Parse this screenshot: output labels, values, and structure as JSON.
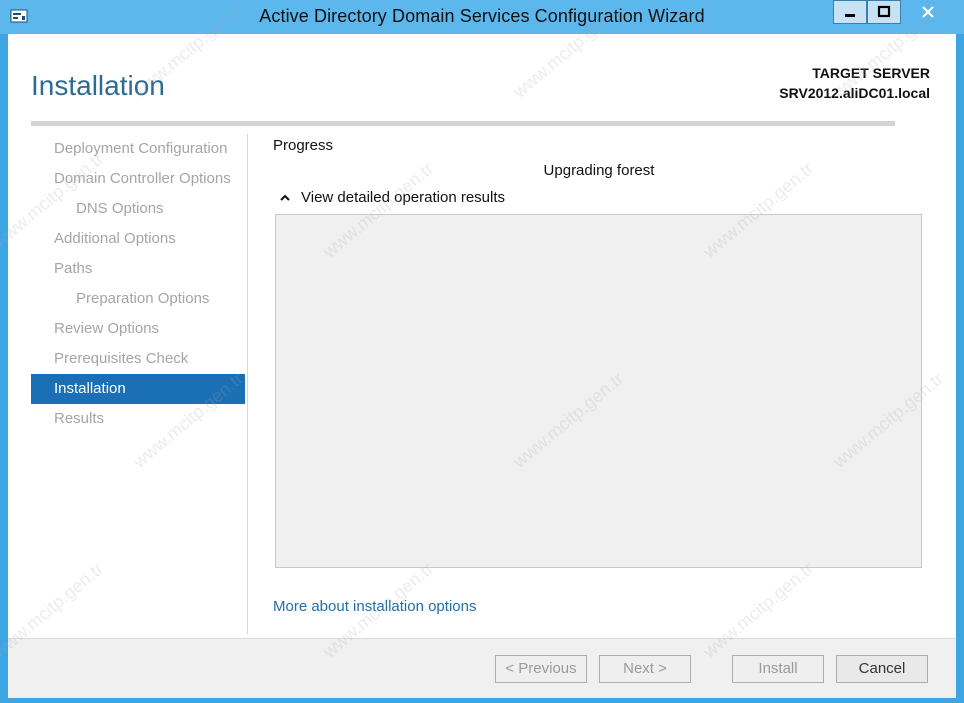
{
  "window": {
    "title": "Active Directory Domain Services Configuration Wizard"
  },
  "header": {
    "page_title": "Installation",
    "target_label": "TARGET SERVER",
    "target_name": "SRV2012.aliDC01.local"
  },
  "nav": {
    "items": [
      {
        "label": "Deployment Configuration"
      },
      {
        "label": "Domain Controller Options"
      },
      {
        "label": "DNS Options"
      },
      {
        "label": "Additional Options"
      },
      {
        "label": "Paths"
      },
      {
        "label": "Preparation Options"
      },
      {
        "label": "Review Options"
      },
      {
        "label": "Prerequisites Check"
      },
      {
        "label": "Installation"
      },
      {
        "label": "Results"
      }
    ]
  },
  "main": {
    "section_label": "Progress",
    "status_text": "Upgrading forest",
    "expander_label": "View detailed operation results",
    "more_link": "More about installation options"
  },
  "footer": {
    "previous_label": "< Previous",
    "next_label": "Next >",
    "install_label": "Install",
    "cancel_label": "Cancel"
  },
  "watermark": {
    "text": "www.mcitp.gen.tr"
  },
  "colors": {
    "titlebar": "#5cb7ec",
    "accent": "#1b6fb4",
    "header_text": "#2c6b93",
    "link": "#1f6fa8"
  }
}
